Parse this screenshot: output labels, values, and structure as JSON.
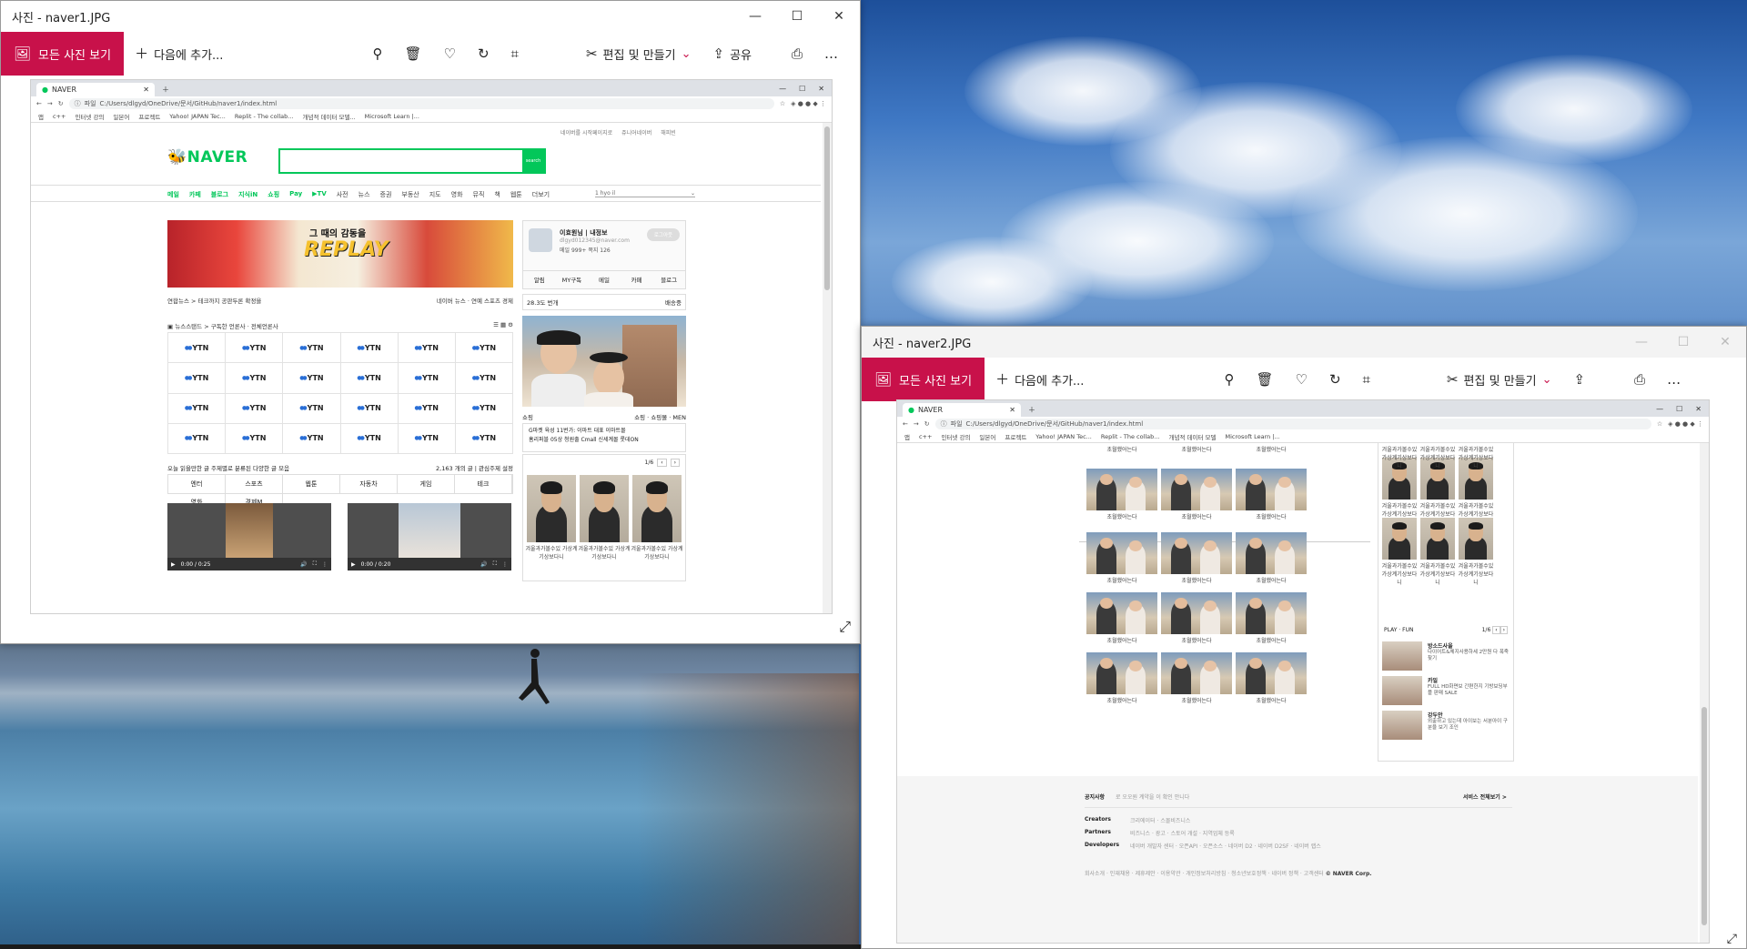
{
  "window1": {
    "title": "사진 - naver1.JPG",
    "all_photos": "모든 사진 보기",
    "add_to": "다음에 추가...",
    "edit_create": "편집 및 만들기",
    "share": "공유"
  },
  "window2": {
    "title": "사진 - naver2.JPG",
    "all_photos": "모든 사진 보기",
    "add_to": "다음에 추가...",
    "edit_create": "편집 및 만들기"
  },
  "browser": {
    "tab_title": "NAVER",
    "url_label": "파일",
    "url": "C:/Users/dlgyd/OneDrive/문서/GitHub/naver1/index.html",
    "url2": "C:/Users/dlgyd/OneDrive/문서/GitHub/naver1/index.html",
    "bookmarks": [
      "앱",
      "c++",
      "인터넷 강의",
      "일본어",
      "프로젝트",
      "Yahoo! JAPAN Tec...",
      "Replit - The collab...",
      "개념적 데이터 모델...",
      "Microsoft Learn |..."
    ],
    "bookmarks2": [
      "앱",
      "c++",
      "인터넷 강의",
      "일본어",
      "프로젝트",
      "Yahoo! JAPAN Tec...",
      "Replit - The collab...",
      "개념적 데이터 모델",
      "Microsoft Learn |..."
    ]
  },
  "naver": {
    "top_links": [
      "네이버를 시작페이지로",
      "쥬니어네이버",
      "해피빈"
    ],
    "logo": "NAVER",
    "search_btn": "search",
    "nav": [
      "메일",
      "카페",
      "블로그",
      "지식iN",
      "쇼핑",
      "Pay",
      "▶TV",
      "사전",
      "뉴스",
      "증권",
      "부동산",
      "지도",
      "영화",
      "뮤직",
      "책",
      "웹툰",
      "더보기"
    ],
    "weather": "1 hyo il",
    "banner_title": "그 때의 감동을",
    "banner_replay": "REPLAY",
    "news_breadcrumb": "연합뉴스 > 테크까지 공판두론 확정을",
    "news_links": "네이버 뉴스 · 연예 스포츠 경제",
    "newsstand": "뉴스스탠드 > 구독한 언론사 · 전체언론사",
    "yt_label": "YTN",
    "today_pick": "오늘 읽을만한 글 주제별로 분류된 다양한 글 모음",
    "today_count": "2,163 개의 글 | 관심주제 설정",
    "categories": [
      "엔터",
      "스포츠",
      "웹툰",
      "자동차",
      "게임",
      "테크",
      "영화",
      "경제M"
    ],
    "video1_time": "0:00 / 0:25",
    "video2_time": "0:00 / 0:20",
    "profile_name": "이효원님 | 내정보",
    "profile_email": "dlgyd012345@naver.com",
    "profile_stats": "메일 999+ 쪽지 126",
    "logout": "로그아웃",
    "profile_tabs": [
      "알림",
      "MY구독",
      "메일",
      "카페",
      "블로그"
    ],
    "pay_text": "28.3도 번개",
    "pay_right": "배송중",
    "shopping_label": "쇼핑",
    "shopping_tabs": "쇼핑 · 쇼핑몰 · MEN",
    "ad_text": "G마켓 육성 11번가: 이마트 대표 이마트몰",
    "ad_text2": "홈리퍼블 05상 청원출 Cmall 신세계몰 롯데ON",
    "pager": "1/6",
    "thumb_caption": "겨울과가볼수있 가상계기상보다니",
    "caption_short": "초월했어는다"
  },
  "naver2": {
    "play_fun": "PLAY · FUN",
    "pager": "1/6",
    "items": [
      {
        "name": "방소드사을",
        "desc": "다이어트&체지사용하세 2만원 다 폭죽찾기"
      },
      {
        "name": "카일",
        "desc": "FULL HD화면보 간편한지 기방보딩부플 판매 SALE"
      },
      {
        "name": "강두안",
        "desc": "외출하고 있는데 아이보는 서분아이 구분을 보기 조인"
      }
    ],
    "footer_notice": "공지사항",
    "footer_notice_text": "로 오오원 계약을 이 확인 안니다",
    "footer_service": "서비스 전체보기 >",
    "creators": "Creators",
    "creators_links": "크리에이터 · 스몰비즈니스",
    "partners": "Partners",
    "partners_links": "비즈니스 · 광고 · 스토어 개설 · 지역업체 등록",
    "developers": "Developers",
    "developers_links": "네이버 개발자 센터 · 오픈API · 오픈소스 · 네이버 D2 · 네이버 D2SF · 네이버 랩스",
    "footer_bottom": "회사소개 · 인재채용 · 제휴제안 · 이용약관 · 개인정보처리방침 · 청소년보호정책 · 네이버 정책 · 고객센터",
    "copyright": "© NAVER Corp."
  },
  "colors": {
    "accent": "#c8114a",
    "naver_green": "#03c75a"
  }
}
